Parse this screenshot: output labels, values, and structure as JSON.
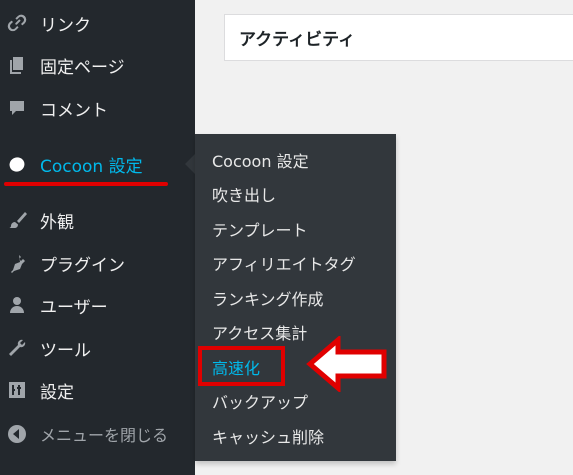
{
  "sidebar": {
    "items": [
      {
        "label": "リンク",
        "icon": "link-icon"
      },
      {
        "label": "固定ページ",
        "icon": "pages-icon"
      },
      {
        "label": "コメント",
        "icon": "comments-icon"
      },
      {
        "label": "Cocoon 設定",
        "icon": "cocoon-icon",
        "active": true
      },
      {
        "label": "外観",
        "icon": "appearance-brush-icon"
      },
      {
        "label": "プラグイン",
        "icon": "plugins-icon"
      },
      {
        "label": "ユーザー",
        "icon": "users-icon"
      },
      {
        "label": "ツール",
        "icon": "tools-wrench-icon"
      },
      {
        "label": "設定",
        "icon": "settings-sliders-icon"
      }
    ],
    "collapse_label": "メニューを閉じる",
    "collapse_icon": "collapse-arrow-icon"
  },
  "flyout": {
    "items": [
      {
        "label": "Cocoon 設定"
      },
      {
        "label": "吹き出し"
      },
      {
        "label": "テンプレート"
      },
      {
        "label": "アフィリエイトタグ"
      },
      {
        "label": "ランキング作成"
      },
      {
        "label": "アクセス集計"
      },
      {
        "label": "高速化",
        "highlighted": true
      },
      {
        "label": "バックアップ"
      },
      {
        "label": "キャッシュ削除"
      }
    ]
  },
  "content": {
    "card_title": "アクティビティ"
  },
  "colors": {
    "sidebar_bg": "#23282d",
    "flyout_bg": "#32373c",
    "active_text": "#00b9eb",
    "annotation_red": "#e00000"
  }
}
